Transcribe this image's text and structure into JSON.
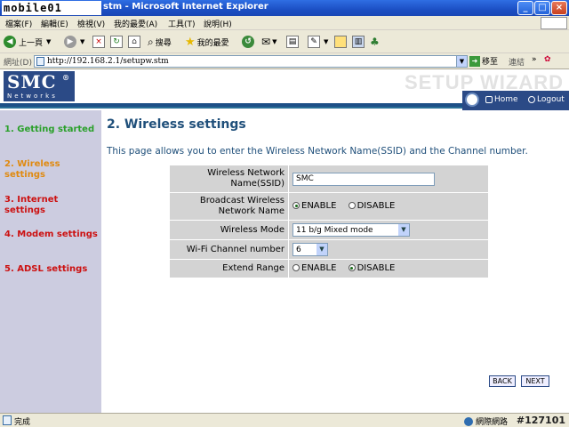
{
  "browser": {
    "logo_text": "mobile01",
    "window_title": "stm - Microsoft Internet Explorer",
    "menu": [
      "檔案(F)",
      "編輯(E)",
      "檢視(V)",
      "我的最愛(A)",
      "工具(T)",
      "說明(H)"
    ],
    "toolbar": {
      "back_label": "上一頁",
      "search_label": "搜尋",
      "favorites_label": "我的最愛"
    },
    "address_label": "網址(D)",
    "address_url": "http://192.168.2.1/setupw.stm",
    "go_label": "移至",
    "links_label": "連結",
    "status_text": "完成",
    "zone_text": "網際網路",
    "watermark": "#127101"
  },
  "page": {
    "logo": {
      "brand": "SMC",
      "reg": "®",
      "sub": "Networks"
    },
    "wizard_title": "SETUP WIZARD",
    "nav": {
      "home": "Home",
      "logout": "Logout"
    },
    "steps": [
      {
        "label": "1. Getting started",
        "color": "#2aa02a"
      },
      {
        "label": "2. Wireless settings",
        "color": "#e08a10"
      },
      {
        "label": "3. Internet settings",
        "color": "#cc1010"
      },
      {
        "label": "4. Modem settings",
        "color": "#cc1010"
      },
      {
        "label": "5. ADSL settings",
        "color": "#cc1010"
      }
    ],
    "heading": "2. Wireless settings",
    "description": "This page allows you to enter the Wireless Network Name(SSID) and the Channel number.",
    "form": {
      "ssid_label": "Wireless Network Name(SSID)",
      "ssid_value": "SMC",
      "broadcast_label": "Broadcast Wireless Network Name",
      "broadcast_enable": "ENABLE",
      "broadcast_disable": "DISABLE",
      "broadcast_selected": "ENABLE",
      "mode_label": "Wireless Mode",
      "mode_value": "11 b/g Mixed mode",
      "channel_label": "Wi-Fi Channel number",
      "channel_value": "6",
      "extend_label": "Extend Range",
      "extend_enable": "ENABLE",
      "extend_disable": "DISABLE",
      "extend_selected": "DISABLE"
    },
    "buttons": {
      "back": "BACK",
      "next": "NEXT"
    }
  }
}
